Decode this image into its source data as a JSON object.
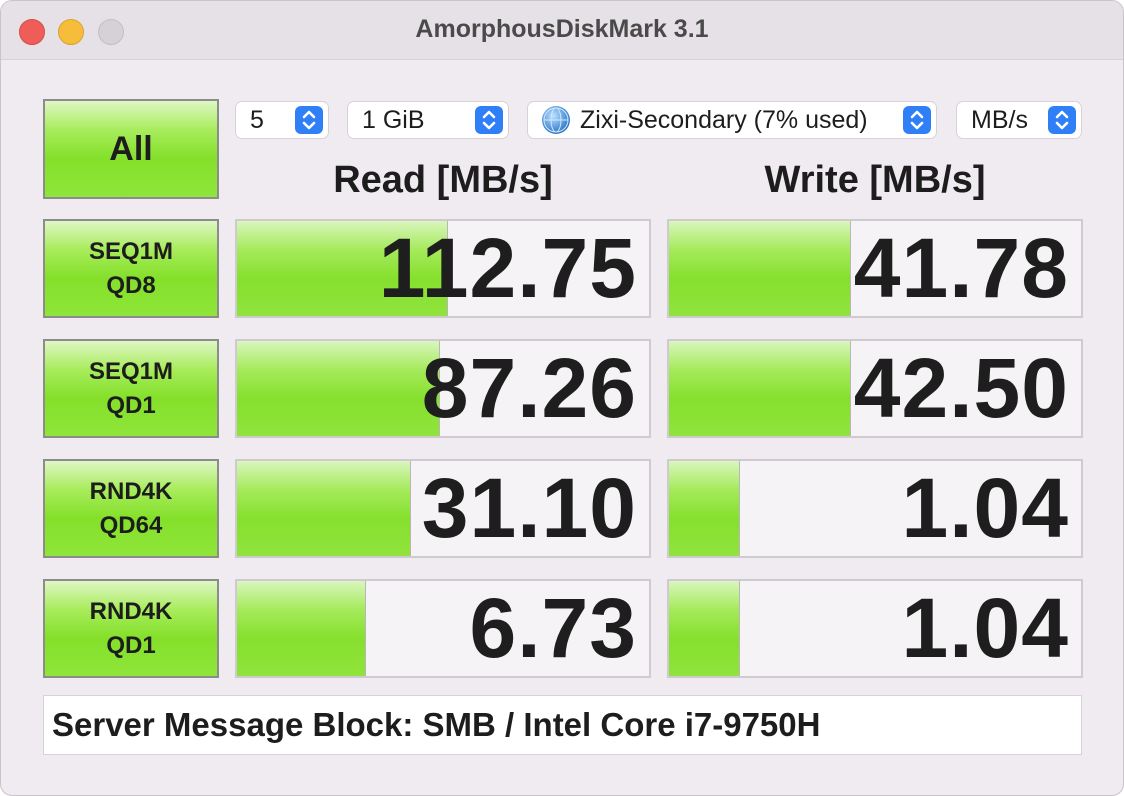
{
  "window": {
    "title": "AmorphousDiskMark 3.1"
  },
  "controls": {
    "all_label": "All",
    "count": "5",
    "size": "1 GiB",
    "target": "Zixi-Secondary (7% used)",
    "unit": "MB/s"
  },
  "headers": {
    "read": "Read [MB/s]",
    "write": "Write [MB/s]"
  },
  "rows": [
    {
      "label_line1": "SEQ1M",
      "label_line2": "QD8",
      "read": "112.75",
      "write": "41.78",
      "read_fill": 0.51,
      "write_fill": 0.44
    },
    {
      "label_line1": "SEQ1M",
      "label_line2": "QD1",
      "read": "87.26",
      "write": "42.50",
      "read_fill": 0.49,
      "write_fill": 0.44
    },
    {
      "label_line1": "RND4K",
      "label_line2": "QD64",
      "read": "31.10",
      "write": "1.04",
      "read_fill": 0.42,
      "write_fill": 0.17
    },
    {
      "label_line1": "RND4K",
      "label_line2": "QD1",
      "read": "6.73",
      "write": "1.04",
      "read_fill": 0.31,
      "write_fill": 0.17
    }
  ],
  "footer": {
    "comment": "Server Message Block: SMB / Intel Core i7-9750H"
  }
}
